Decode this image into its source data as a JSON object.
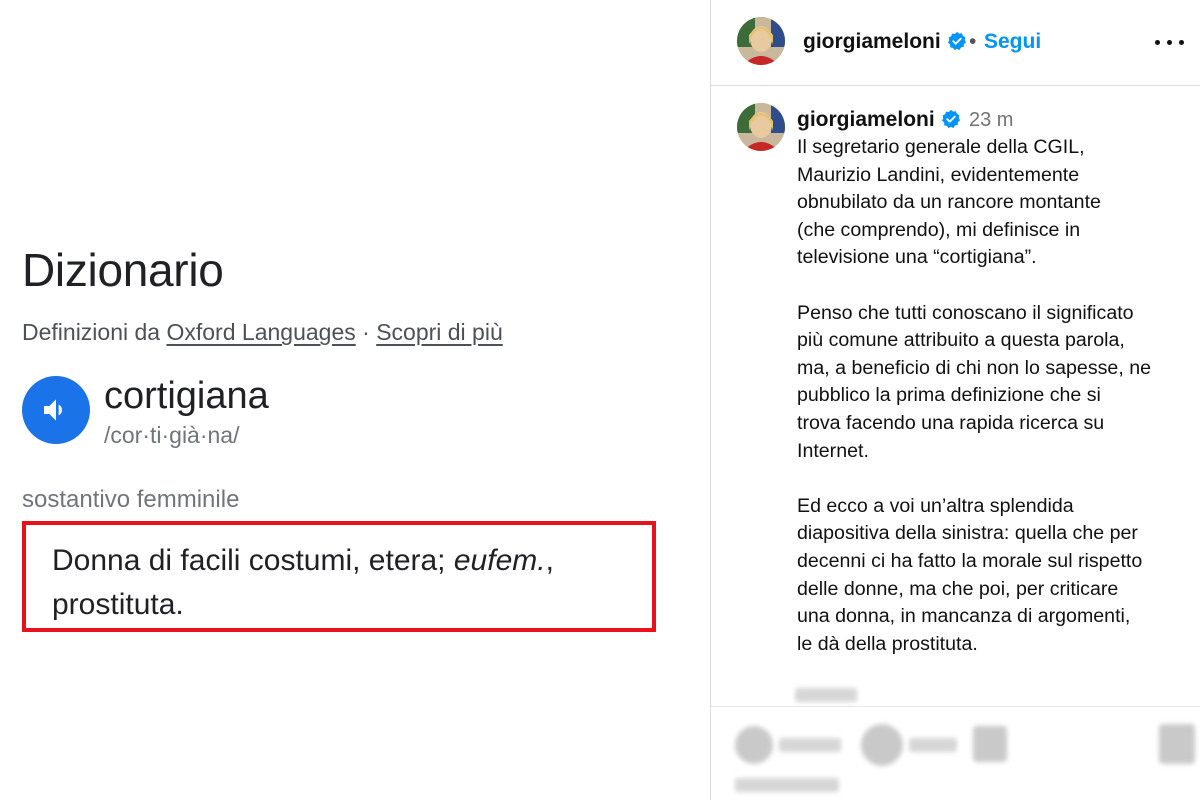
{
  "dictionary": {
    "title": "Dizionario",
    "source_prefix": "Definizioni da",
    "source_link": "Oxford Languages",
    "source_separator": "·",
    "more_link": "Scopri di più",
    "word": "cortigiana",
    "phonetic": "/cor·ti·già·na/",
    "part_of_speech": "sostantivo femminile",
    "definition_before": "Donna di facili costumi, etera; ",
    "definition_italic": "eufem.",
    "definition_after": ", prostituta.",
    "speaker_icon": "speaker-icon",
    "highlight_color": "#e8131a",
    "accent_color": "#1a73e8"
  },
  "instagram": {
    "header": {
      "username": "giorgiameloni",
      "dot": "•",
      "follow_label": "Segui",
      "verified_icon": "verified-badge-icon",
      "more_icon": "more-options-icon"
    },
    "post": {
      "username": "giorgiameloni",
      "time": "23 m",
      "caption": "Il segretario generale della CGIL,\nMaurizio Landini, evidentemente\nobnubilato da un rancore montante\n(che comprendo), mi definisce in\ntelevisione una “cortigiana”.\n\nPenso che tutti conoscano il significato\npiù comune attribuito a questa parola,\nma, a beneficio di chi non lo sapesse, ne\npubblico la prima definizione che si\ntrova facendo una rapida ricerca su\nInternet.\n\nEd ecco a voi un’altra splendida\ndiapositiva della sinistra: quella che per\ndecenni ci ha fatto la morale sul rispetto\ndelle donne, ma che poi, per criticare\nuna donna, in mancanza di argomenti,\nle dà della prostituta."
    },
    "action_icons": [
      "like-icon",
      "comment-icon",
      "share-icon",
      "save-icon"
    ],
    "follow_color": "#0095f6"
  }
}
